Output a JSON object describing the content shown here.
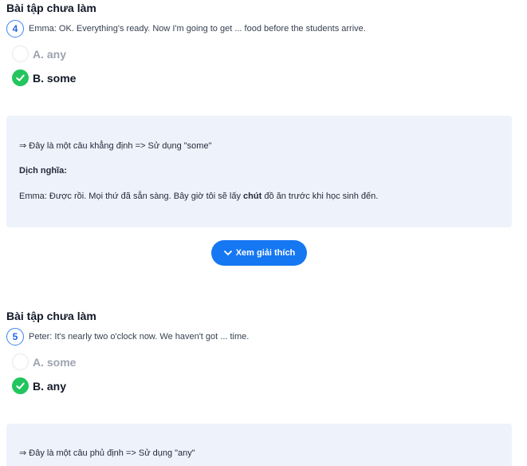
{
  "questions": [
    {
      "section_title": "Bài tập chưa làm",
      "number": "4",
      "text": "Emma: OK. Everything's ready. Now I'm going to get ... food before the students arrive.",
      "options": [
        {
          "label": "A. any",
          "state": "unselected"
        },
        {
          "label": "B. some",
          "state": "correct"
        }
      ],
      "explanation": {
        "rule": "⇒ Đây là một câu khẳng định => Sử dụng \"some\"",
        "translation_heading": "Dịch nghĩa:",
        "translation_before": "Emma: Được rồi. Mọi thứ đã sẵn sàng. Bây giờ tôi sẽ lấy ",
        "translation_bold": "chút",
        "translation_after": " đồ ăn trước khi học sinh đến."
      },
      "toggle_button": "Xem giải thích"
    },
    {
      "section_title": "Bài tập chưa làm",
      "number": "5",
      "text": "Peter: It's nearly two o'clock now. We haven't got ... time.",
      "options": [
        {
          "label": "A. some",
          "state": "unselected"
        },
        {
          "label": "B. any",
          "state": "correct"
        }
      ],
      "explanation": {
        "rule": "⇒ Đây là một câu phủ định => Sử dụng \"any\""
      }
    }
  ],
  "colors": {
    "accent": "#1677f2",
    "correct": "#22c55e",
    "explanation_bg": "#eef2fb",
    "muted_option": "#9ca3af"
  }
}
